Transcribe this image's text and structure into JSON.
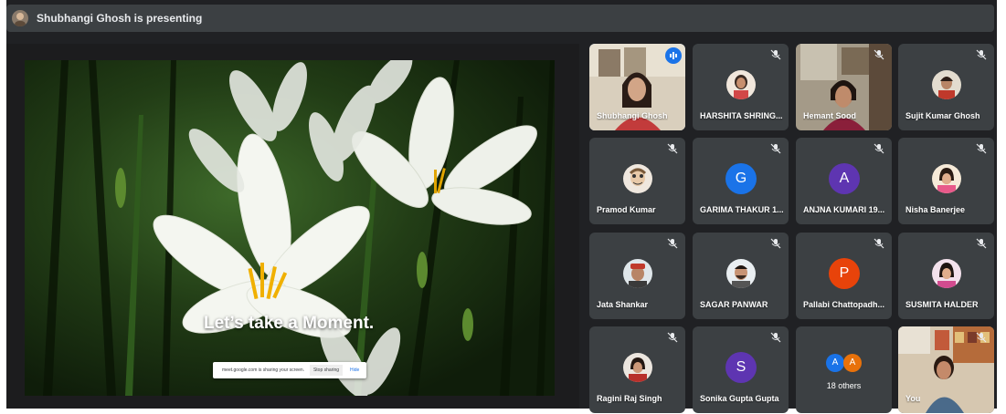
{
  "topbar": {
    "presenting_text": "Shubhangi Ghosh is presenting"
  },
  "slide": {
    "caption": "Let’s take a Moment.",
    "share_bar": {
      "message": "meet.google.com is sharing your screen.",
      "stop_label": "Stop sharing",
      "hide_label": "Hide"
    }
  },
  "participants": [
    {
      "name": "Shubhangi Ghosh"
    },
    {
      "name": "HARSHITA SHRING..."
    },
    {
      "name": "Hemant Sood"
    },
    {
      "name": "Sujit Kumar Ghosh"
    },
    {
      "name": "Pramod Kumar"
    },
    {
      "name": "GARIMA THAKUR 1...",
      "initial": "G"
    },
    {
      "name": "ANJNA KUMARI 19...",
      "initial": "A"
    },
    {
      "name": "Nisha Banerjee"
    },
    {
      "name": "Jata Shankar"
    },
    {
      "name": "SAGAR PANWAR"
    },
    {
      "name": "Pallabi Chattopadh...",
      "initial": "P"
    },
    {
      "name": "SUSMITA HALDER"
    },
    {
      "name": "Ragini Raj Singh"
    },
    {
      "name": "Sonika Gupta Gupta",
      "initial": "S"
    },
    {
      "name": "18 others",
      "initials": [
        "A",
        "A"
      ]
    },
    {
      "name": "You"
    }
  ],
  "colors": {
    "tile": "#3c4043",
    "accent": "#1a73e8",
    "g": "#1a73e8",
    "a": "#5e35b1",
    "p": "#e8430a",
    "s": "#5e35b1"
  }
}
